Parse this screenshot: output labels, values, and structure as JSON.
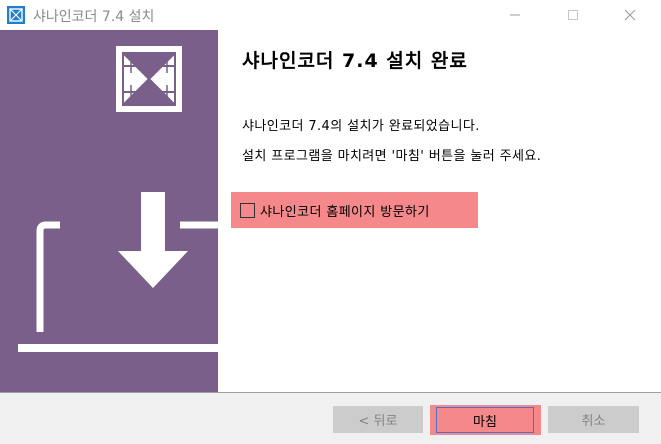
{
  "window": {
    "title": "샤나인코더 7.4 설치",
    "controls": [
      "minimize",
      "maximize",
      "close"
    ]
  },
  "banner": {
    "background": "#795f8a",
    "logo_icon": "shana-logo-icon",
    "illustration": "download-to-laptop-icon"
  },
  "content": {
    "heading": "샤나인코더 7.4 설치 완료",
    "line1": "샤나인코더 7.4의 설치가 완료되었습니다.",
    "line2": "설치 프로그램을 마치려면 '마침' 버튼을 눌러 주세요.",
    "checkbox": {
      "label": "샤나인코더 홈페이지 방문하기",
      "checked": false,
      "highlight": "#f4888a"
    }
  },
  "buttons": {
    "back": "< 뒤로",
    "finish": "마침",
    "cancel": "취소"
  }
}
